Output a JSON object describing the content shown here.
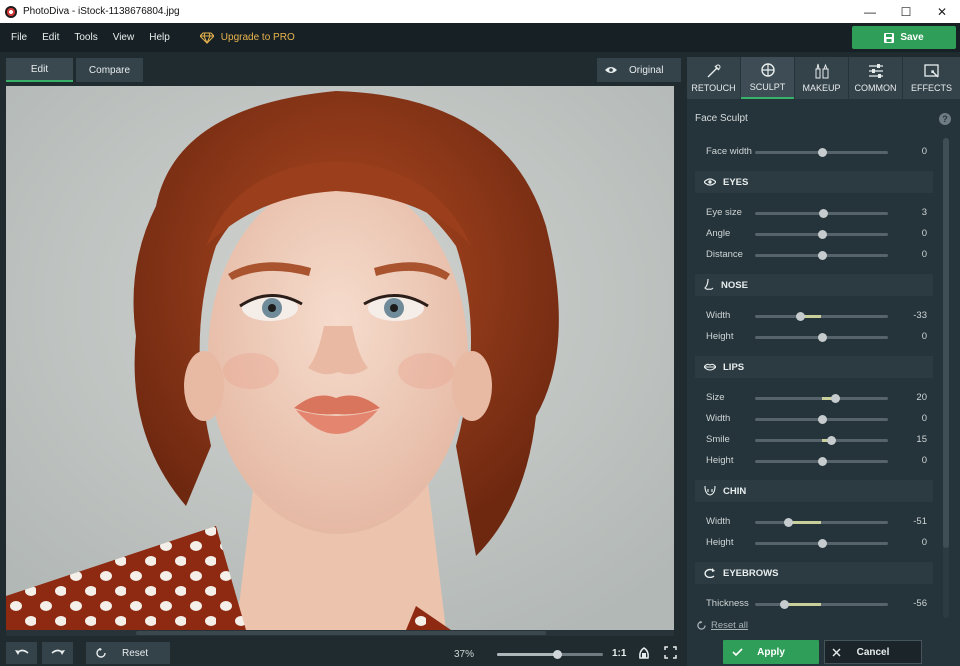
{
  "window": {
    "title": "PhotoDiva - iStock-1138676804.jpg",
    "controls": [
      "minimize-icon",
      "maximize-icon",
      "close-icon"
    ]
  },
  "menu": {
    "items": [
      "File",
      "Edit",
      "Tools",
      "View",
      "Help"
    ],
    "upgrade_label": "Upgrade to PRO",
    "save_label": "Save"
  },
  "canvas_toolbar": {
    "edit_label": "Edit",
    "compare_label": "Compare",
    "original_label": "Original"
  },
  "bottom_bar": {
    "reset_label": "Reset",
    "zoom_text": "37%",
    "zoom_level": 0.57,
    "one_to_one": "1:1"
  },
  "tabs": [
    {
      "label": "RETOUCH",
      "icon": "retouch-icon",
      "active": false
    },
    {
      "label": "SCULPT",
      "icon": "sculpt-icon",
      "active": true
    },
    {
      "label": "MAKEUP",
      "icon": "makeup-icon",
      "active": false
    },
    {
      "label": "COMMON",
      "icon": "common-sliders-icon",
      "active": false
    },
    {
      "label": "EFFECTS",
      "icon": "effects-icon",
      "active": false
    }
  ],
  "panel": {
    "section_title": "Face Sculpt",
    "help": "?",
    "face_width": {
      "label": "Face width",
      "value": "0",
      "level": 0
    },
    "groups": [
      {
        "title": "EYES",
        "icon": "eye-icon",
        "sliders": [
          {
            "label": "Eye size",
            "value": "3",
            "level": 3
          },
          {
            "label": "Angle",
            "value": "0",
            "level": 0
          },
          {
            "label": "Distance",
            "value": "0",
            "level": 0
          }
        ]
      },
      {
        "title": "NOSE",
        "icon": "nose-icon",
        "sliders": [
          {
            "label": "Width",
            "value": "-33",
            "level": -33
          },
          {
            "label": "Height",
            "value": "0",
            "level": 0
          }
        ]
      },
      {
        "title": "LIPS",
        "icon": "lips-icon",
        "sliders": [
          {
            "label": "Size",
            "value": "20",
            "level": 20
          },
          {
            "label": "Width",
            "value": "0",
            "level": 0
          },
          {
            "label": "Smile",
            "value": "15",
            "level": 15
          },
          {
            "label": "Height",
            "value": "0",
            "level": 0
          }
        ]
      },
      {
        "title": "CHIN",
        "icon": "chin-icon",
        "sliders": [
          {
            "label": "Width",
            "value": "-51",
            "level": -51
          },
          {
            "label": "Height",
            "value": "0",
            "level": 0
          }
        ]
      },
      {
        "title": "EYEBROWS",
        "icon": "eyebrows-icon",
        "sliders": [
          {
            "label": "Thickness",
            "value": "-56",
            "level": -56
          }
        ]
      }
    ],
    "reset_all_label": "Reset all",
    "apply_label": "Apply",
    "cancel_label": "Cancel"
  }
}
